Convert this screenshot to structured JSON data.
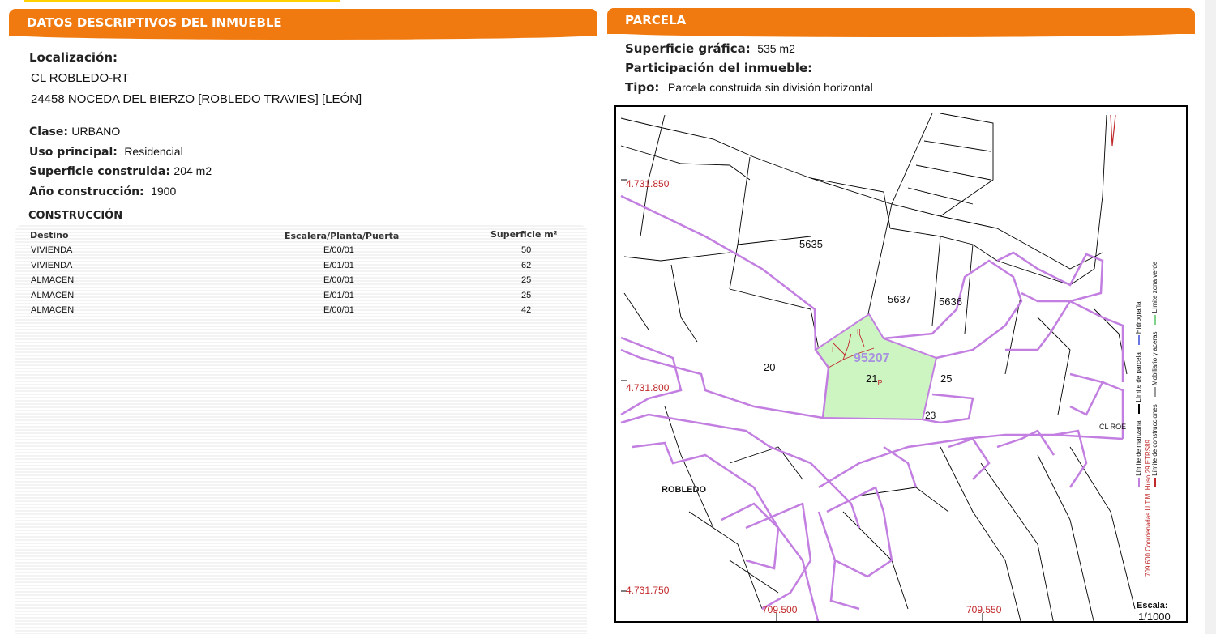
{
  "left": {
    "title": "DATOS DESCRIPTIVOS DEL INMUEBLE",
    "localizacion_label": "Localización:",
    "address_line1": "CL ROBLEDO-RT",
    "address_line2": "24458 NOCEDA DEL BIERZO [ROBLEDO TRAVIES] [LEÓN]",
    "clase_label": "Clase:",
    "clase_value": "URBANO",
    "uso_label": "Uso principal:",
    "uso_value": "Residencial",
    "superficie_label": "Superficie construida:",
    "superficie_value": "204 m2",
    "anio_label": "Año construcción:",
    "anio_value": "1900",
    "construccion_title": "CONSTRUCCIÓN",
    "table": {
      "headers": [
        "Destino",
        "Escalera/Planta/Puerta",
        "Superficie m²"
      ],
      "rows": [
        [
          "VIVIENDA",
          "E/00/01",
          "50"
        ],
        [
          "VIVIENDA",
          "E/01/01",
          "62"
        ],
        [
          "ALMACEN",
          "E/00/01",
          "25"
        ],
        [
          "ALMACEN",
          "E/01/01",
          "25"
        ],
        [
          "ALMACEN",
          "E/00/01",
          "42"
        ]
      ]
    }
  },
  "right": {
    "title": "PARCELA",
    "sup_label": "Superficie gráfica:",
    "sup_value": "535 m2",
    "part_label": "Participación del inmueble:",
    "tipo_label": "Tipo:",
    "tipo_value": "Parcela construida sin división horizontal"
  },
  "map": {
    "parcel_number": "95207",
    "parcels": [
      "5635",
      "5637",
      "5636",
      "20",
      "25",
      "23"
    ],
    "parcel_21": "21",
    "parcel_21_sub": "P",
    "block_labels": [
      "I",
      "II"
    ],
    "street_label": "CL ROE",
    "place_label": "ROBLEDO",
    "y_coords": [
      "4.731.850",
      "4.731.800",
      "4.731.750"
    ],
    "x_coords": [
      "709.500",
      "709.550"
    ],
    "legend": {
      "manzana": "Límite de manzana",
      "construcciones": "Límite de construcciones",
      "parcela": "Límite de parcela",
      "mobiliario": "Mobiliario y aceras",
      "hidrografia": "Hidrografía",
      "zona_verde": "Límite zona verde"
    },
    "coord_system": "709.600 Coordenadas U.T.M. Huso 29 ETRS89",
    "scale_label": "Escala:",
    "scale_value": "1/1000"
  },
  "colors": {
    "header_orange": "#f07a0f",
    "parcel_fill": "#ccf5c2",
    "block_outline": "#c27ee0",
    "coord_red": "#c0282a"
  }
}
